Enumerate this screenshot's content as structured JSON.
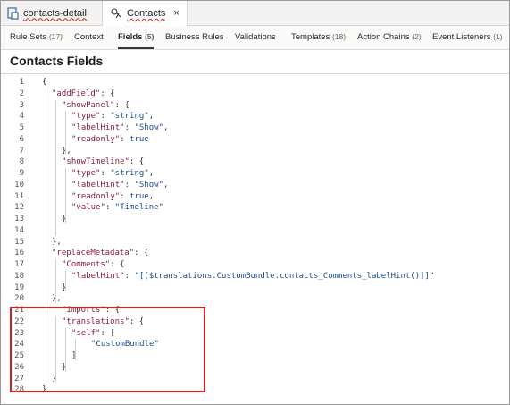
{
  "file_tabs": [
    {
      "label": "contacts-detail",
      "icon": "file-icon",
      "active": false
    },
    {
      "label": "Contacts",
      "icon": "business-object-icon",
      "active": true,
      "close": "×"
    }
  ],
  "section_tabs": [
    {
      "label": "Rule Sets",
      "count": "(17)"
    },
    {
      "label": "Context",
      "count": ""
    },
    {
      "label": "Fields",
      "count": "(5)",
      "active": true
    },
    {
      "label": "Business Rules",
      "count": ""
    },
    {
      "label": "Validations",
      "count": ""
    },
    {
      "label": "Templates",
      "count": "(18)"
    },
    {
      "label": "Action Chains",
      "count": "(2)"
    },
    {
      "label": "Event Listeners",
      "count": "(1)"
    }
  ],
  "page_title": "Contacts Fields",
  "code_lines": [
    {
      "n": "1",
      "indent": 0,
      "tokens": [
        [
          "pun",
          "{"
        ]
      ]
    },
    {
      "n": "2",
      "indent": 1,
      "tokens": [
        [
          "key",
          "\"addField\""
        ],
        [
          "pun",
          ": {"
        ]
      ]
    },
    {
      "n": "3",
      "indent": 2,
      "tokens": [
        [
          "key",
          "\"showPanel\""
        ],
        [
          "pun",
          ": {"
        ]
      ]
    },
    {
      "n": "4",
      "indent": 3,
      "tokens": [
        [
          "key",
          "\"type\""
        ],
        [
          "pun",
          ": "
        ],
        [
          "str",
          "\"string\""
        ],
        [
          "pun",
          ","
        ]
      ]
    },
    {
      "n": "5",
      "indent": 3,
      "tokens": [
        [
          "key",
          "\"labelHint\""
        ],
        [
          "pun",
          ": "
        ],
        [
          "str",
          "\"Show\""
        ],
        [
          "pun",
          ","
        ]
      ]
    },
    {
      "n": "6",
      "indent": 3,
      "tokens": [
        [
          "key",
          "\"readonly\""
        ],
        [
          "pun",
          ": "
        ],
        [
          "kw",
          "true"
        ]
      ]
    },
    {
      "n": "7",
      "indent": 2,
      "tokens": [
        [
          "pun",
          "},"
        ]
      ]
    },
    {
      "n": "8",
      "indent": 2,
      "tokens": [
        [
          "key",
          "\"showTimeline\""
        ],
        [
          "pun",
          ": {"
        ]
      ]
    },
    {
      "n": "9",
      "indent": 3,
      "tokens": [
        [
          "key",
          "\"type\""
        ],
        [
          "pun",
          ": "
        ],
        [
          "str",
          "\"string\""
        ],
        [
          "pun",
          ","
        ]
      ]
    },
    {
      "n": "10",
      "indent": 3,
      "tokens": [
        [
          "key",
          "\"labelHint\""
        ],
        [
          "pun",
          ": "
        ],
        [
          "str",
          "\"Show\""
        ],
        [
          "pun",
          ","
        ]
      ]
    },
    {
      "n": "11",
      "indent": 3,
      "tokens": [
        [
          "key",
          "\"readonly\""
        ],
        [
          "pun",
          ": "
        ],
        [
          "kw",
          "true"
        ],
        [
          "pun",
          ","
        ]
      ]
    },
    {
      "n": "12",
      "indent": 3,
      "tokens": [
        [
          "key",
          "\"value\""
        ],
        [
          "pun",
          ": "
        ],
        [
          "str",
          "\"Timeline\""
        ]
      ]
    },
    {
      "n": "13",
      "indent": 2,
      "tokens": [
        [
          "pun",
          "}"
        ]
      ]
    },
    {
      "n": "14",
      "indent": 0,
      "tokens": []
    },
    {
      "n": "15",
      "indent": 1,
      "tokens": [
        [
          "pun",
          "},"
        ]
      ]
    },
    {
      "n": "16",
      "indent": 1,
      "tokens": [
        [
          "key",
          "\"replaceMetadata\""
        ],
        [
          "pun",
          ": {"
        ]
      ]
    },
    {
      "n": "17",
      "indent": 2,
      "tokens": [
        [
          "key",
          "\"Comments\""
        ],
        [
          "pun",
          ": {"
        ]
      ]
    },
    {
      "n": "18",
      "indent": 3,
      "tokens": [
        [
          "key",
          "\"labelHint\""
        ],
        [
          "pun",
          ": "
        ],
        [
          "str",
          "\"[[$translations.CustomBundle.contacts_Comments_labelHint()]]\""
        ]
      ]
    },
    {
      "n": "19",
      "indent": 2,
      "tokens": [
        [
          "pun",
          "}"
        ]
      ]
    },
    {
      "n": "20",
      "indent": 1,
      "tokens": [
        [
          "pun",
          "},"
        ]
      ]
    },
    {
      "n": "21",
      "indent": 2,
      "tokens": [
        [
          "key",
          "\"imports\""
        ],
        [
          "pun",
          ": {"
        ]
      ]
    },
    {
      "n": "22",
      "indent": 2,
      "tokens": [
        [
          "key",
          "\"translations\""
        ],
        [
          "pun",
          ": {"
        ]
      ]
    },
    {
      "n": "23",
      "indent": 3,
      "tokens": [
        [
          "key",
          "\"self\""
        ],
        [
          "pun",
          ": ["
        ]
      ]
    },
    {
      "n": "24",
      "indent": 5,
      "tokens": [
        [
          "str",
          "\"CustomBundle\""
        ]
      ]
    },
    {
      "n": "25",
      "indent": 3,
      "tokens": [
        [
          "pun",
          "]"
        ]
      ]
    },
    {
      "n": "26",
      "indent": 2,
      "tokens": [
        [
          "pun",
          "}"
        ]
      ]
    },
    {
      "n": "27",
      "indent": 1,
      "tokens": [
        [
          "pun",
          "}"
        ]
      ]
    },
    {
      "n": "28",
      "indent": 0,
      "tokens": [
        [
          "pun",
          "}"
        ]
      ]
    }
  ],
  "colors": {
    "highlight_border": "#d71f26",
    "json_key": "#8a1c3a",
    "json_string": "#1c4c8a"
  }
}
